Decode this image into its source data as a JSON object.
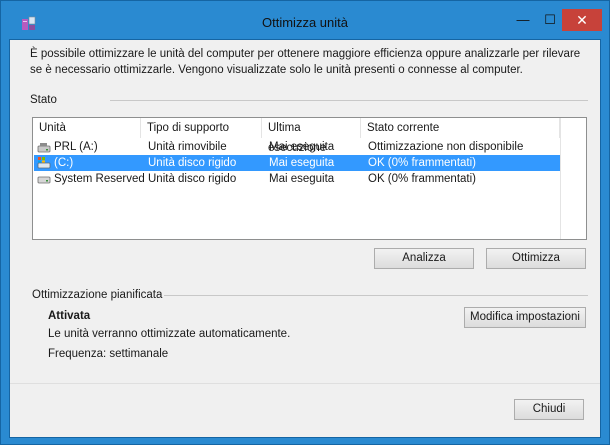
{
  "window": {
    "title": "Ottimizza unità",
    "minimize": "—",
    "maximize": "☐",
    "close": "✕"
  },
  "intro": {
    "text": "È possibile ottimizzare le unità del computer per ottenere maggiore efficienza oppure analizzarle per rilevare se è necessario ottimizzarle. Vengono visualizzate solo le unità presenti o connesse al computer."
  },
  "status_section": {
    "label": "Stato",
    "columns": [
      "Unità",
      "Tipo di supporto",
      "Ultima esecuzione",
      "Stato corrente"
    ],
    "rows": [
      {
        "unit": "PRL (A:)",
        "media": "Unità rimovibile",
        "last_run": "Mai eseguita",
        "status": "Ottimizzazione non disponibile",
        "selected": false
      },
      {
        "unit": "(C:)",
        "media": "Unità disco rigido",
        "last_run": "Mai eseguita",
        "status": "OK (0% frammentati)",
        "selected": true
      },
      {
        "unit": "System Reserved",
        "media": "Unità disco rigido",
        "last_run": "Mai eseguita",
        "status": "OK (0% frammentati)",
        "selected": false
      }
    ]
  },
  "buttons": {
    "analyze": "Analizza",
    "optimize": "Ottimizza",
    "change_settings": "Modifica impostazioni",
    "close": "Chiudi"
  },
  "scheduled": {
    "label": "Ottimizzazione pianificata",
    "state": "Attivata",
    "description": "Le unità verranno ottimizzate automaticamente.",
    "frequency": "Frequenza: settimanale"
  },
  "colors": {
    "title_bar": "#2a8ad1",
    "close_button": "#c7423a",
    "selection": "#3399ff"
  }
}
